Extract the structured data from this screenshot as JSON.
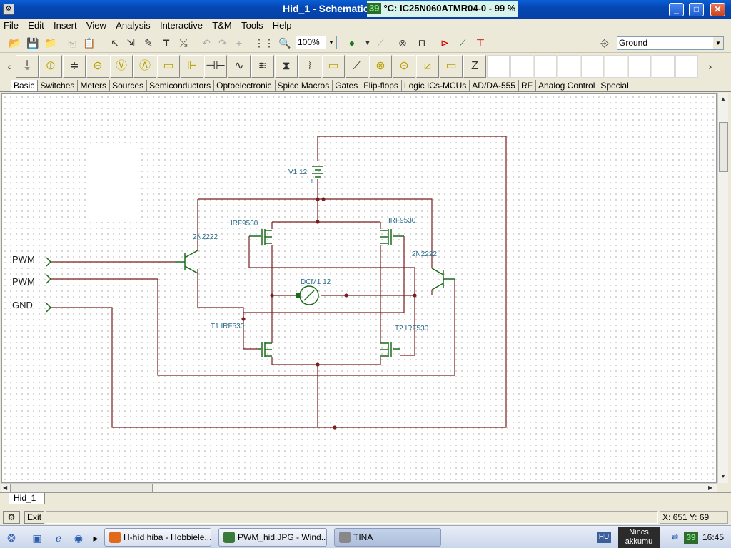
{
  "window": {
    "title": "Hid_1 - Schematic",
    "overlay_temp": "39",
    "overlay_text": "°C: IC25N060ATMR04-0 - 99 %",
    "buttons": {
      "minimize": "_",
      "maximize": "□",
      "close": "✕"
    }
  },
  "menu": [
    "File",
    "Edit",
    "Insert",
    "View",
    "Analysis",
    "Interactive",
    "T&M",
    "Tools",
    "Help"
  ],
  "toolbar": {
    "zoom": "100%",
    "ground_select": "Ground"
  },
  "component_tabs": [
    "Basic",
    "Switches",
    "Meters",
    "Sources",
    "Semiconductors",
    "Optoelectronic",
    "Spice Macros",
    "Gates",
    "Flip-flops",
    "Logic ICs-MCUs",
    "AD/DA-555",
    "RF",
    "Analog Control",
    "Special"
  ],
  "schematic": {
    "ports": [
      "PWM",
      "PWM",
      "GND"
    ],
    "v1": "V1 12",
    "plus_sign": "+",
    "motor": "DCM1 12",
    "q_left": "2N2222",
    "q_right": "2N2222",
    "p_left": "IRF9530",
    "p_right": "IRF9530",
    "t1": "T1 IRF530",
    "t2": "T2 IRF530"
  },
  "sheet_tab": "Hid_1",
  "status": {
    "exit_label": "Exit",
    "coords": "X: 651  Y: 69"
  },
  "taskbar": {
    "items": [
      {
        "label": "H-híd hiba - Hobbiele...",
        "icon_color": "#e06a1a"
      },
      {
        "label": "PWM_hid.JPG - Wind...",
        "icon_color": "#3a7a3a"
      },
      {
        "label": "TINA",
        "icon_color": "#888888"
      }
    ],
    "lang": "HU",
    "user": "Nincs\nakkumu",
    "temp": "39",
    "time": "16:45"
  }
}
